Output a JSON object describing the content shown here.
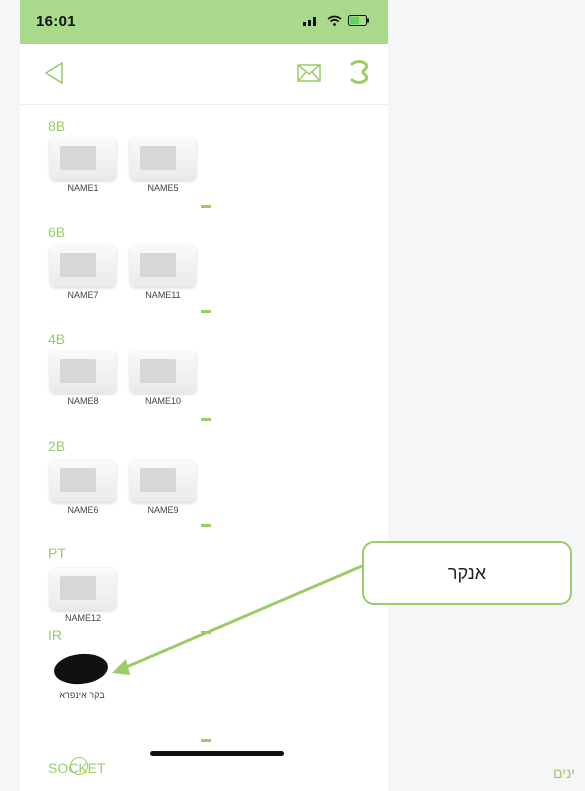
{
  "status": {
    "time": "16:01"
  },
  "colors": {
    "accent": "#9ccc65",
    "statusbar": "#a9d98a"
  },
  "header": {
    "back_icon": "back-icon",
    "mail_icon": "mail-icon",
    "refresh_icon": "refresh-icon"
  },
  "sections": [
    {
      "title": "8B",
      "devices": [
        "NAME1",
        "NAME5"
      ]
    },
    {
      "title": "6B",
      "devices": [
        "NAME7",
        "NAME11"
      ]
    },
    {
      "title": "4B",
      "devices": [
        "NAME8",
        "NAME10"
      ]
    },
    {
      "title": "2B",
      "devices": [
        "NAME6",
        "NAME9"
      ]
    },
    {
      "title": "PT",
      "devices": [
        "NAME12"
      ]
    },
    {
      "title": "IR",
      "devices": [
        "בקר אינפרא"
      ]
    },
    {
      "title": "SOCKET",
      "devices": []
    }
  ],
  "callout": {
    "text": "אנקר"
  },
  "edge_text": "ינים"
}
